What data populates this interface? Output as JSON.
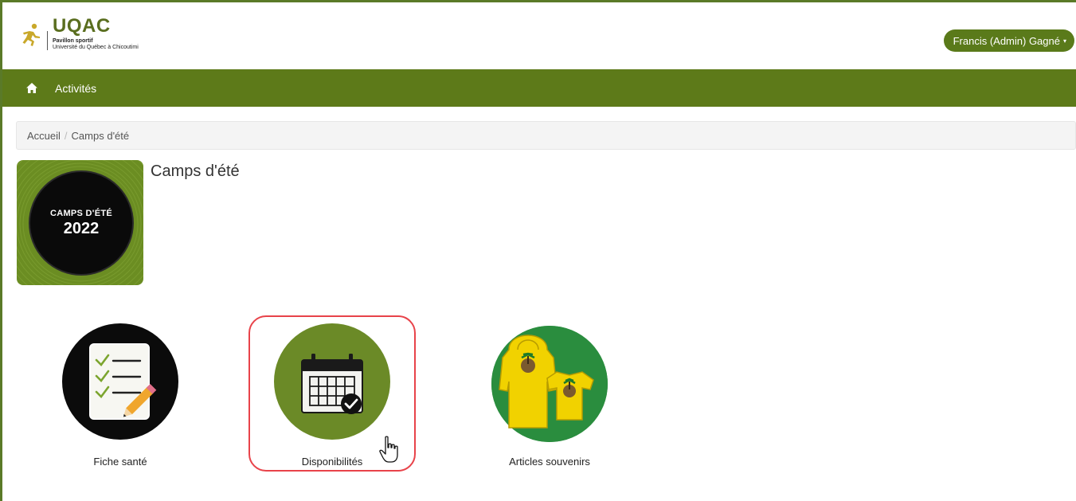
{
  "header": {
    "logo_name": "UQAC",
    "logo_sub1": "Pavillon sportif",
    "logo_sub2": "Université du Québec à Chicoutimi",
    "user_menu_label": "Francis (Admin) Gagné",
    "user_menu_caret": "▾"
  },
  "nav": {
    "home_icon": "home-icon",
    "items": [
      {
        "label": "Activités"
      }
    ]
  },
  "breadcrumb": {
    "items": [
      {
        "label": "Accueil"
      },
      {
        "label": "Camps d'été"
      }
    ],
    "separator": "/"
  },
  "page": {
    "title": "Camps d'été",
    "banner_line1": "CAMPS D'ÉTÉ",
    "banner_line2": "2022"
  },
  "tiles": [
    {
      "label": "Fiche santé",
      "icon": "checklist-icon"
    },
    {
      "label": "Disponibilités",
      "icon": "calendar-check-icon",
      "selected": true
    },
    {
      "label": "Articles souvenirs",
      "icon": "souvenir-clothing-icon"
    }
  ],
  "colors": {
    "brand_green": "#5d7a19",
    "highlight_red": "#e8434a",
    "souvenir_green": "#2a8d3e",
    "clothing_yellow": "#f1d200"
  }
}
